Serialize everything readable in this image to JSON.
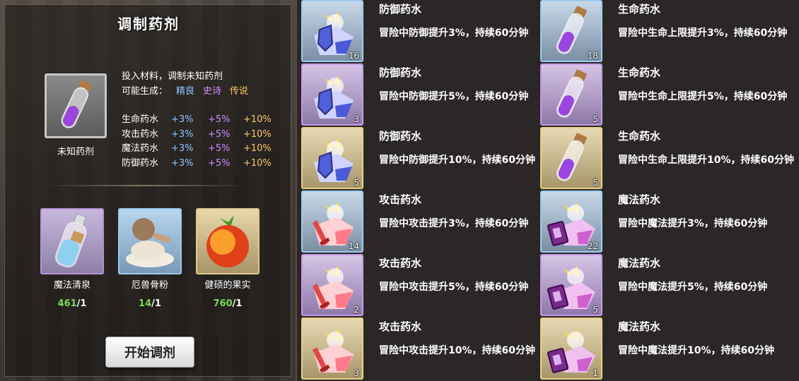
{
  "panel": {
    "title": "调制药剂",
    "potion_name": "未知药剂",
    "intro": "投入材料，调制未知药剂",
    "possible_label": "可能生成：",
    "quality_fine": "精良",
    "quality_epic": "史诗",
    "quality_legend": "传说",
    "table": [
      {
        "name": "生命药水",
        "fine": "+3%",
        "epic": "+5%",
        "legend": "+10%"
      },
      {
        "name": "攻击药水",
        "fine": "+3%",
        "epic": "+5%",
        "legend": "+10%"
      },
      {
        "name": "魔法药水",
        "fine": "+3%",
        "epic": "+5%",
        "legend": "+10%"
      },
      {
        "name": "防御药水",
        "fine": "+3%",
        "epic": "+5%",
        "legend": "+10%"
      }
    ],
    "materials": [
      {
        "name": "魔法清泉",
        "have": "461",
        "need": "/1"
      },
      {
        "name": "厄兽骨粉",
        "have": "14",
        "need": "/1"
      },
      {
        "name": "健硕的果实",
        "have": "760",
        "need": "/1"
      }
    ],
    "start_button": "开始调剂"
  },
  "potions": [
    {
      "name": "防御药水",
      "desc": "冒险中防御提升3%，持续60分钟",
      "count": "16",
      "rarity": "fine",
      "kind": "defense"
    },
    {
      "name": "生命药水",
      "desc": "冒险中生命上限提升3%，持续60分钟",
      "count": "18",
      "rarity": "fine",
      "kind": "life"
    },
    {
      "name": "防御药水",
      "desc": "冒险中防御提升5%，持续60分钟",
      "count": "3",
      "rarity": "epic",
      "kind": "defense"
    },
    {
      "name": "生命药水",
      "desc": "冒险中生命上限提升5%，持续60分钟",
      "count": "5",
      "rarity": "epic",
      "kind": "life"
    },
    {
      "name": "防御药水",
      "desc": "冒险中防御提升10%，持续60分钟",
      "count": "5",
      "rarity": "legend",
      "kind": "defense"
    },
    {
      "name": "生命药水",
      "desc": "冒险中生命上限提升10%，持续60分钟",
      "count": "5",
      "rarity": "legend",
      "kind": "life"
    },
    {
      "name": "攻击药水",
      "desc": "冒险中攻击提升3%，持续60分钟",
      "count": "14",
      "rarity": "fine",
      "kind": "attack"
    },
    {
      "name": "魔法药水",
      "desc": "冒险中魔法提升3%，持续60分钟",
      "count": "22",
      "rarity": "fine",
      "kind": "magic"
    },
    {
      "name": "攻击药水",
      "desc": "冒险中攻击提升5%，持续60分钟",
      "count": "2",
      "rarity": "epic",
      "kind": "attack"
    },
    {
      "name": "魔法药水",
      "desc": "冒险中魔法提升5%，持续60分钟",
      "count": "5",
      "rarity": "epic",
      "kind": "magic"
    },
    {
      "name": "攻击药水",
      "desc": "冒险中攻击提升10%，持续60分钟",
      "count": "3",
      "rarity": "legend",
      "kind": "attack"
    },
    {
      "name": "魔法药水",
      "desc": "冒险中魔法提升10%，持续60分钟",
      "count": "1",
      "rarity": "legend",
      "kind": "magic"
    }
  ],
  "colors": {
    "fine": "#8ec8ff",
    "epic": "#d28cff",
    "legend": "#ffc76a",
    "have": "#7ed957"
  }
}
